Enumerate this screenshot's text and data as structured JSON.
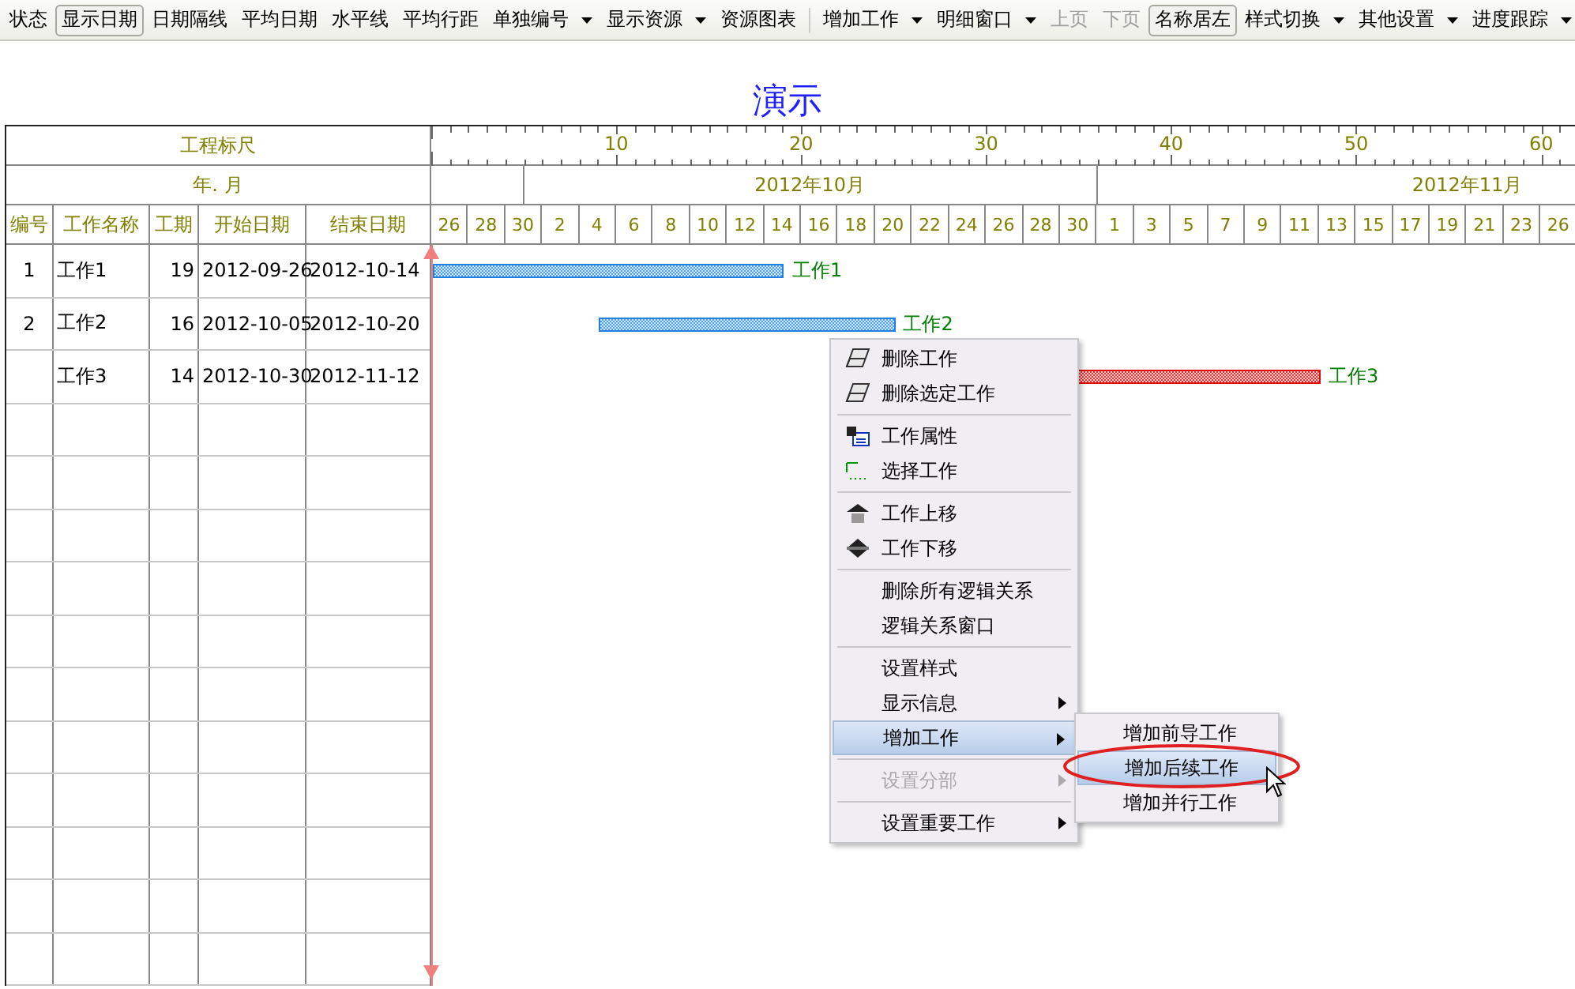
{
  "toolbar": {
    "groups": [
      [
        {
          "label": "状态",
          "pressed": false,
          "dropdown": false,
          "disabled": false
        },
        {
          "label": "显示日期",
          "pressed": true,
          "dropdown": false,
          "disabled": false
        },
        {
          "label": "日期隔线",
          "pressed": false,
          "dropdown": false,
          "disabled": false
        },
        {
          "label": "平均日期",
          "pressed": false,
          "dropdown": false,
          "disabled": false
        },
        {
          "label": "水平线",
          "pressed": false,
          "dropdown": false,
          "disabled": false
        },
        {
          "label": "平均行距",
          "pressed": false,
          "dropdown": false,
          "disabled": false
        },
        {
          "label": "单独编号",
          "pressed": false,
          "dropdown": true,
          "disabled": false
        },
        {
          "label": "显示资源",
          "pressed": false,
          "dropdown": true,
          "disabled": false
        },
        {
          "label": "资源图表",
          "pressed": false,
          "dropdown": false,
          "disabled": false
        }
      ],
      [
        {
          "label": "增加工作",
          "pressed": false,
          "dropdown": true,
          "disabled": false
        },
        {
          "label": "明细窗口",
          "pressed": false,
          "dropdown": true,
          "disabled": false
        },
        {
          "label": "上页",
          "pressed": false,
          "dropdown": false,
          "disabled": true
        },
        {
          "label": "下页",
          "pressed": false,
          "dropdown": false,
          "disabled": true
        },
        {
          "label": "名称居左",
          "pressed": true,
          "dropdown": false,
          "disabled": false
        },
        {
          "label": "样式切换",
          "pressed": false,
          "dropdown": true,
          "disabled": false
        },
        {
          "label": "其他设置",
          "pressed": false,
          "dropdown": true,
          "disabled": false
        },
        {
          "label": "进度跟踪",
          "pressed": false,
          "dropdown": true,
          "disabled": false
        }
      ]
    ]
  },
  "title": "演示",
  "table": {
    "ruler_label": "工程标尺",
    "month_label": "年. 月",
    "columns": [
      "编号",
      "工作名称",
      "工期",
      "开始日期",
      "结束日期"
    ],
    "rows": [
      {
        "number": "1",
        "name": "工作1",
        "duration": "19",
        "start": "2012-09-26",
        "end": "2012-10-14",
        "critical": false,
        "bar_label": "工作1"
      },
      {
        "number": "2",
        "name": "工作2",
        "duration": "16",
        "start": "2012-10-05",
        "end": "2012-10-20",
        "critical": false,
        "bar_label": "工作2"
      },
      {
        "name": "工作3",
        "duration": "14",
        "start": "2012-10-30",
        "end": "2012-11-12",
        "critical": true,
        "bar_label": "工作3"
      }
    ]
  },
  "timeline": {
    "ruler_labels": [
      "10",
      "20",
      "30",
      "40",
      "50",
      "60"
    ],
    "months": [
      "2012年10月",
      "2012年11月"
    ],
    "days": [
      "26",
      "28",
      "30",
      "2",
      "4",
      "6",
      "8",
      "10",
      "12",
      "14",
      "16",
      "18",
      "20",
      "22",
      "24",
      "26",
      "28",
      "30",
      "1",
      "3",
      "5",
      "7",
      "9",
      "11",
      "13",
      "15",
      "17",
      "19",
      "21",
      "23",
      "26"
    ]
  },
  "context_menu": {
    "groups": [
      [
        {
          "label": "删除工作",
          "submenu": false,
          "disabled": false,
          "selected": false
        },
        {
          "label": "删除选定工作",
          "submenu": false,
          "disabled": false,
          "selected": false
        }
      ],
      [
        {
          "label": "工作属性",
          "submenu": false,
          "disabled": false,
          "selected": false
        },
        {
          "label": "选择工作",
          "submenu": false,
          "disabled": false,
          "selected": false
        }
      ],
      [
        {
          "label": "工作上移",
          "submenu": false,
          "disabled": false,
          "selected": false
        },
        {
          "label": "工作下移",
          "submenu": false,
          "disabled": false,
          "selected": false
        }
      ],
      [
        {
          "label": "删除所有逻辑关系",
          "submenu": false,
          "disabled": false,
          "selected": false
        },
        {
          "label": "逻辑关系窗口",
          "submenu": false,
          "disabled": false,
          "selected": false
        }
      ],
      [
        {
          "label": "设置样式",
          "submenu": false,
          "disabled": false,
          "selected": false
        },
        {
          "label": "显示信息",
          "submenu": true,
          "disabled": false,
          "selected": false
        },
        {
          "label": "增加工作",
          "submenu": true,
          "disabled": false,
          "selected": true
        }
      ],
      [
        {
          "label": "设置分部",
          "submenu": true,
          "disabled": true,
          "selected": false
        }
      ],
      [
        {
          "label": "设置重要工作",
          "submenu": true,
          "disabled": false,
          "selected": false
        }
      ]
    ],
    "submenu": [
      {
        "label": "增加前导工作",
        "selected": false
      },
      {
        "label": "增加后续工作",
        "selected": true
      },
      {
        "label": "增加并行工作",
        "selected": false
      }
    ]
  }
}
